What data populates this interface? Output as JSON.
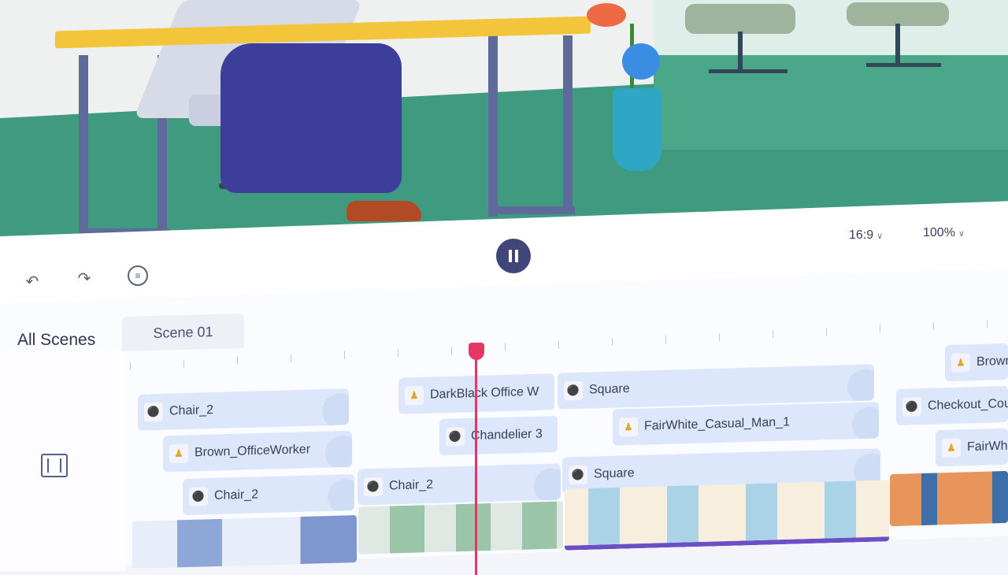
{
  "preview": {
    "aspect_ratio": "16:9",
    "zoom": "100%",
    "pause_icon": "pause-icon"
  },
  "toolbar": {
    "undo_icon": "undo-icon",
    "redo_icon": "redo-icon",
    "voice_icon": "voice-wave-icon",
    "fit_icon": "fit-width-icon"
  },
  "tabs": {
    "all_scenes": "All Scenes",
    "scene": "Scene 01"
  },
  "clips": [
    {
      "label": "Chair_2",
      "kind": "object"
    },
    {
      "label": "Brown_OfficeWorker",
      "kind": "character"
    },
    {
      "label": "Chair_2",
      "kind": "object"
    },
    {
      "label": "DarkBlack Office W",
      "kind": "character"
    },
    {
      "label": "Chandelier 3",
      "kind": "object"
    },
    {
      "label": "Chair_2",
      "kind": "object"
    },
    {
      "label": "Square",
      "kind": "object"
    },
    {
      "label": "FairWhite_Casual_Man_1",
      "kind": "character"
    },
    {
      "label": "Square",
      "kind": "object"
    },
    {
      "label": "Brown_",
      "kind": "character"
    },
    {
      "label": "Checkout_Count",
      "kind": "object"
    },
    {
      "label": "FairWhite",
      "kind": "character"
    }
  ],
  "colors": {
    "accent": "#404678",
    "playhead": "#e53764",
    "clip": "#dce7fb"
  }
}
